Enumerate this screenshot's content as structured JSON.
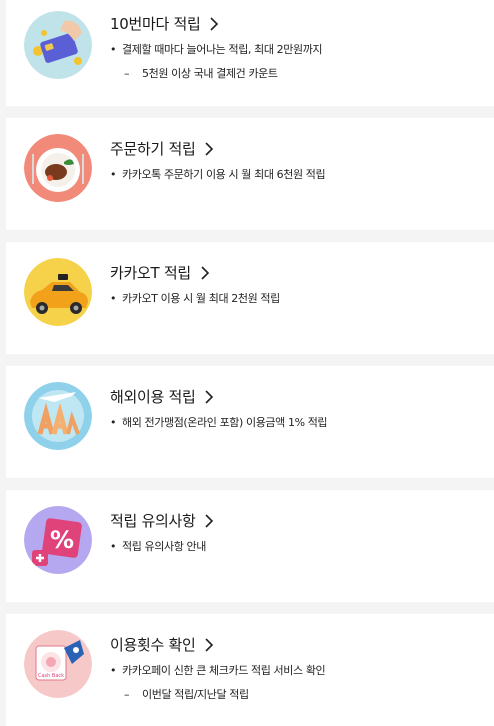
{
  "items": [
    {
      "title": "10번마다 적립",
      "icon": "card-payment-icon",
      "lines": [
        {
          "text": "결제할 때마다 늘어나는 적립, 최대 2만원까지",
          "kind": "bullet"
        },
        {
          "text": "5천원 이상 국내 결제건 카운트",
          "kind": "sub"
        }
      ]
    },
    {
      "title": "주문하기 적립",
      "icon": "food-plate-icon",
      "lines": [
        {
          "text": "카카오톡 주문하기 이용 시 월 최대 6천원 적립",
          "kind": "bullet"
        }
      ]
    },
    {
      "title": "카카오T 적립",
      "icon": "taxi-icon",
      "lines": [
        {
          "text": "카카오T 이용 시 월 최대 2천원 적립",
          "kind": "bullet"
        }
      ]
    },
    {
      "title": "해외이용 적립",
      "icon": "airplane-icon",
      "lines": [
        {
          "text": "해외 전가맹점(온라인 포함) 이용금액 1% 적립",
          "kind": "bullet"
        }
      ]
    },
    {
      "title": "적립 유의사항",
      "icon": "percent-icon",
      "lines": [
        {
          "text": "적립 유의사항 안내",
          "kind": "bullet"
        }
      ]
    },
    {
      "title": "이용횟수 확인",
      "icon": "cashback-icon",
      "logo_text": "Cash Back",
      "lines": [
        {
          "text": "카카오페이 신한 큰 체크카드 적립 서비스 확인",
          "kind": "bullet"
        },
        {
          "text": "이번달 적립/지난달 적립",
          "kind": "sub"
        }
      ]
    }
  ],
  "symbols": {
    "bullet": "•",
    "dash": "–"
  },
  "colors": {
    "background": "#f4f4f4",
    "card": "#ffffff",
    "text": "#1a1a1a"
  }
}
